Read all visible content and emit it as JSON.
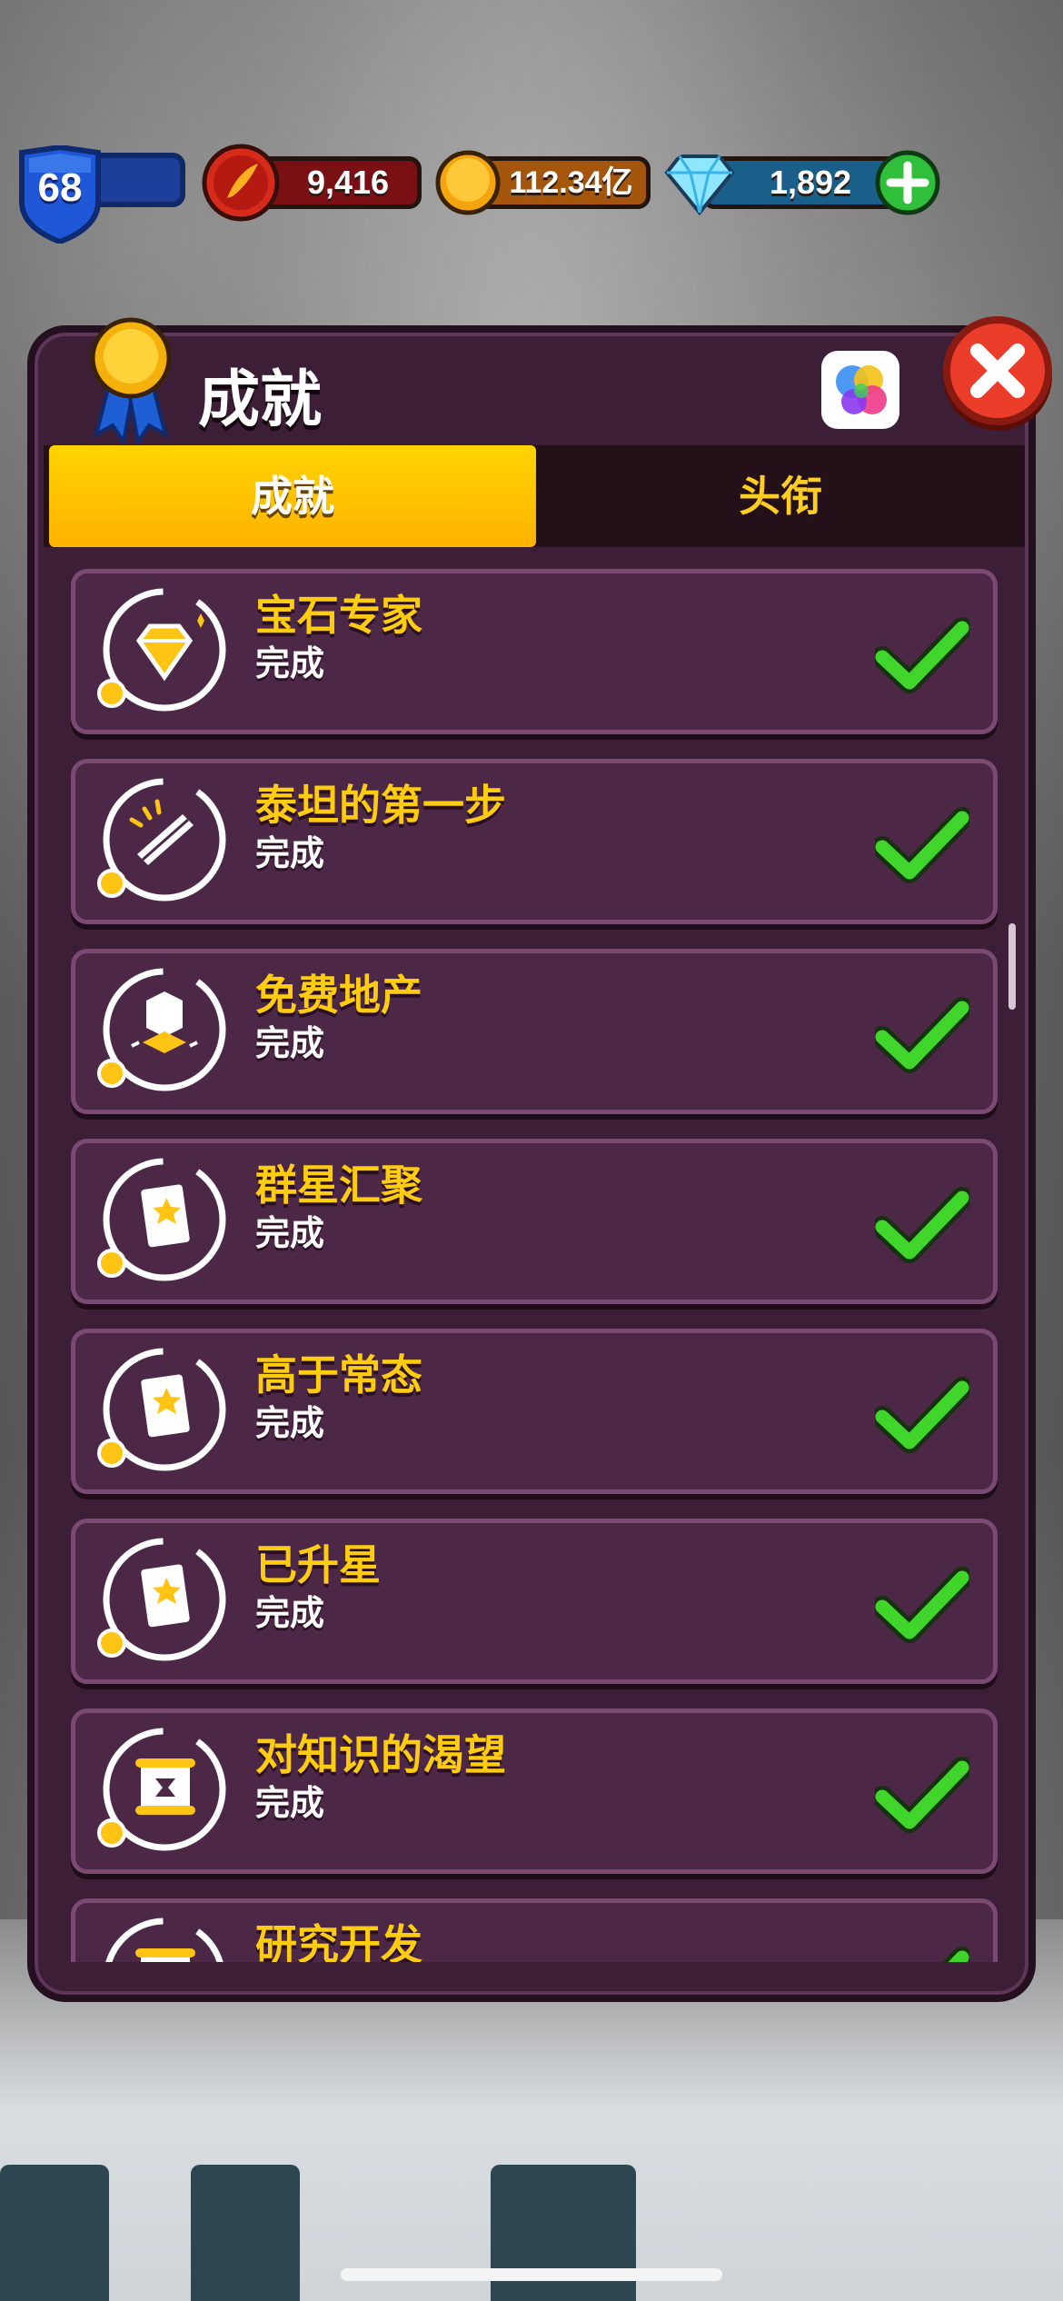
{
  "topbar": {
    "level": "68",
    "energy": "9,416",
    "coins": "112.34亿",
    "gems": "1,892"
  },
  "panel": {
    "title": "成就",
    "tabs": [
      {
        "label": "成就",
        "active": true
      },
      {
        "label": "头衔",
        "active": false
      }
    ]
  },
  "achievements": [
    {
      "name": "宝石专家",
      "status": "完成",
      "icon": "gem-icon",
      "completed": true
    },
    {
      "name": "泰坦的第一步",
      "status": "完成",
      "icon": "scroll-icon",
      "completed": true
    },
    {
      "name": "免费地产",
      "status": "完成",
      "icon": "land-icon",
      "completed": true
    },
    {
      "name": "群星汇聚",
      "status": "完成",
      "icon": "star-card-icon",
      "completed": true
    },
    {
      "name": "高于常态",
      "status": "完成",
      "icon": "star-card-icon",
      "completed": true
    },
    {
      "name": "已升星",
      "status": "完成",
      "icon": "star-card-icon",
      "completed": true
    },
    {
      "name": "对知识的渴望",
      "status": "完成",
      "icon": "research-scroll-icon",
      "completed": true
    },
    {
      "name": "研究开发",
      "status": "",
      "icon": "research-scroll-icon",
      "completed": true
    }
  ],
  "colors": {
    "panel_bg": "#3c1f36",
    "tab_active": "#ffcc00",
    "achievement_name": "#ffcc10",
    "check_green": "#3fd52a",
    "close_red": "#ec3d2a"
  }
}
